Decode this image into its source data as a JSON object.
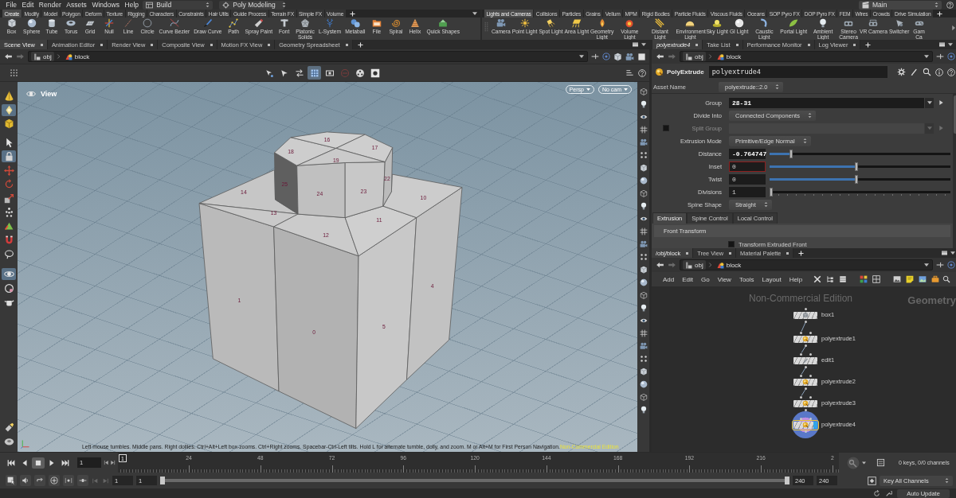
{
  "menu_bar": {
    "menus": [
      "File",
      "Edit",
      "Render",
      "Assets",
      "Windows",
      "Help"
    ],
    "desktop": "Build",
    "shelf_set": "Poly Modeling",
    "context": "Main"
  },
  "shelf_left": {
    "tabs": [
      {
        "label": "Create",
        "selected": true
      },
      {
        "label": "Modify",
        "selected": false
      },
      {
        "label": "Model",
        "selected": false
      },
      {
        "label": "Polygon",
        "selected": false
      },
      {
        "label": "Deform",
        "selected": false
      },
      {
        "label": "Texture",
        "selected": false
      },
      {
        "label": "Rigging",
        "selected": false
      },
      {
        "label": "Characters",
        "selected": false
      },
      {
        "label": "Constraints",
        "selected": false
      },
      {
        "label": "Hair Utils",
        "selected": false
      },
      {
        "label": "Guide Process",
        "selected": false
      },
      {
        "label": "Terrain FX",
        "selected": false
      },
      {
        "label": "Simple FX",
        "selected": false
      },
      {
        "label": "Volume",
        "selected": false
      }
    ],
    "tools": [
      "Box",
      "Sphere",
      "Tube",
      "Torus",
      "Grid",
      "Null",
      "Line",
      "Circle",
      "Curve Bezier",
      "Draw Curve",
      "Path",
      "Spray Paint",
      "Font",
      "Platonic\nSolids",
      "L-System",
      "Metaball",
      "File",
      "Spiral",
      "Helix",
      "Quick Shapes"
    ]
  },
  "shelf_right": {
    "tabs": [
      {
        "label": "Lights and Cameras",
        "selected": true
      },
      {
        "label": "Collisions",
        "selected": false
      },
      {
        "label": "Particles",
        "selected": false
      },
      {
        "label": "Grains",
        "selected": false
      },
      {
        "label": "Vellum",
        "selected": false
      },
      {
        "label": "MPM",
        "selected": false
      },
      {
        "label": "Rigid Bodies",
        "selected": false
      },
      {
        "label": "Particle Fluids",
        "selected": false
      },
      {
        "label": "Viscous Fluids",
        "selected": false
      },
      {
        "label": "Oceans",
        "selected": false
      },
      {
        "label": "SOP Pyro FX",
        "selected": false
      },
      {
        "label": "DOP Pyro FX",
        "selected": false
      },
      {
        "label": "FEM",
        "selected": false
      },
      {
        "label": "Wires",
        "selected": false
      },
      {
        "label": "Crowds",
        "selected": false
      },
      {
        "label": "Drive Simulation",
        "selected": false
      }
    ],
    "tools": [
      "Camera",
      "Point Light",
      "Spot Light",
      "Area Light",
      "Geometry\nLight",
      "Volume Light",
      "Distant Light",
      "Environment\nLight",
      "Sky Light",
      "GI Light",
      "Caustic Light",
      "Portal Light",
      "Ambient Light",
      "Stereo\nCamera",
      "VR Camera",
      "Switcher",
      "Gam\nCa"
    ]
  },
  "pane_tabs_left": [
    {
      "label": "Scene View",
      "selected": true
    },
    {
      "label": "Animation Editor",
      "selected": false
    },
    {
      "label": "Render View",
      "selected": false
    },
    {
      "label": "Composite View",
      "selected": false
    },
    {
      "label": "Motion FX View",
      "selected": false
    },
    {
      "label": "Geometry Spreadsheet",
      "selected": false
    }
  ],
  "pane_tabs_right": [
    {
      "label": "polyextrude4",
      "selected": true
    },
    {
      "label": "Take List",
      "selected": false
    },
    {
      "label": "Performance Monitor",
      "selected": false
    },
    {
      "label": "Log Viewer",
      "selected": false
    }
  ],
  "scene_view": {
    "path": [
      "obj",
      "block"
    ],
    "toolbar": [
      {
        "on": false,
        "disabled": false
      },
      {
        "on": false,
        "disabled": false
      },
      {
        "on": false,
        "disabled": false
      },
      {
        "on": true,
        "disabled": false
      },
      {
        "on": false,
        "disabled": false
      },
      {
        "on": false,
        "disabled": true
      },
      {
        "on": false,
        "disabled": false
      },
      {
        "on": false,
        "disabled": false
      }
    ],
    "tools": [
      {
        "selected": false
      },
      {
        "selected": true
      },
      {
        "selected": false
      },
      {
        "selected": false
      },
      {
        "selected": true
      },
      {
        "selected": false
      },
      {
        "selected": false
      },
      {
        "selected": false
      },
      {
        "selected": false
      },
      {
        "selected": false
      },
      {
        "selected": false
      },
      {
        "selected": false
      },
      {
        "selected": true
      },
      {
        "selected": false
      },
      {
        "selected": false
      },
      {
        "selected": false
      },
      {
        "selected": false
      }
    ],
    "title": "View",
    "view_menus": [
      "Persp",
      "No cam"
    ],
    "primitive_numbers": [
      "16",
      "17",
      "18",
      "19",
      "25",
      "24",
      "23",
      "22",
      "14",
      "13",
      "12",
      "11",
      "10",
      "1",
      "0",
      "5",
      "4"
    ],
    "hint": "Left mouse tumbles. Middle pans. Right dollies. Ctrl+Alt+Left box-zooms. Ctrl+Right zooms. Spacebar-Ctrl-Left tilts. Hold L for alternate tumble, dolly, and zoom. M or Alt+M for First Person Navigation.",
    "edition": "Non-Commercial Edition"
  },
  "parameters": {
    "path": [
      "obj",
      "block"
    ],
    "node_type": "PolyExtrude",
    "node_name": "polyextrude4",
    "asset_label": "Asset Name",
    "asset_name": "polyextrude::2.0",
    "fields": [
      {
        "kind": "group",
        "label": "Group",
        "value": "28-31",
        "changed": true,
        "disabled": false,
        "focused": false
      },
      {
        "kind": "menu",
        "label": "Divide Into",
        "value": "Connected Components",
        "changed": false,
        "disabled": false,
        "focused": false
      },
      {
        "kind": "group",
        "label": "Split Group",
        "toggle": false,
        "changed": false,
        "disabled": true,
        "focused": false
      },
      {
        "kind": "menu",
        "label": "Extrusion Mode",
        "value": "Primitive/Edge Normal",
        "changed": false,
        "disabled": false,
        "focused": false
      },
      {
        "kind": "slider",
        "label": "Distance",
        "value": "-0.764747",
        "level": 0.11,
        "changed": true,
        "disabled": false,
        "focused": false
      },
      {
        "kind": "slider",
        "label": "Inset",
        "value": "0",
        "level": 0.48,
        "changed": false,
        "disabled": false,
        "focused": true
      },
      {
        "kind": "slider",
        "label": "Twist",
        "value": "0",
        "level": 0.48,
        "changed": false,
        "disabled": false,
        "focused": false
      },
      {
        "kind": "int_slider",
        "label": "Divisions",
        "value": "1",
        "level": 0,
        "changed": false,
        "disabled": false,
        "focused": false
      },
      {
        "kind": "menu",
        "label": "Spine Shape",
        "value": "Straight",
        "changed": false,
        "disabled": false,
        "focused": false
      }
    ],
    "tabs": [
      {
        "label": "Extrusion",
        "selected": true
      },
      {
        "label": "Spine Control",
        "selected": false
      },
      {
        "label": "Local Control",
        "selected": false
      }
    ],
    "folder": "Front Transform",
    "toggle": {
      "label": "Transform Extruded Front",
      "checked": false
    }
  },
  "network": {
    "tabs": [
      {
        "label": "/obj/block",
        "selected": true
      },
      {
        "label": "Tree View",
        "selected": false
      },
      {
        "label": "Material Palette",
        "selected": false
      }
    ],
    "path": [
      "obj",
      "block"
    ],
    "menus": [
      "Add",
      "Edit",
      "Go",
      "View",
      "Tools",
      "Layout",
      "Help"
    ],
    "edition": "Non-Commercial Edition",
    "context": "Geometry",
    "nodes": [
      {
        "name": "box1",
        "kind": "box",
        "selected": false,
        "display": false
      },
      {
        "name": "polyextrude1",
        "kind": "polyextrude",
        "selected": false,
        "display": false
      },
      {
        "name": "edit1",
        "kind": "edit",
        "selected": false,
        "display": false
      },
      {
        "name": "polyextrude2",
        "kind": "polyextrude",
        "selected": false,
        "display": false
      },
      {
        "name": "polyextrude3",
        "kind": "polyextrude",
        "selected": false,
        "display": false
      },
      {
        "name": "polyextrude4",
        "kind": "polyextrude",
        "selected": true,
        "display": true
      }
    ]
  },
  "playbar": {
    "playing": false,
    "frame": "1",
    "current_frame": "1",
    "ticks": [
      "24",
      "48",
      "72",
      "96",
      "120",
      "144",
      "168",
      "192",
      "216",
      "2"
    ],
    "keys": "0 keys, 0/0 channels"
  },
  "range_bar": {
    "start": "1",
    "range_start": "1",
    "level": 1,
    "range_end": "240",
    "end": "240",
    "key_mode": "Key All Channels"
  },
  "status_bar": {
    "update_mode": "Auto Update"
  }
}
